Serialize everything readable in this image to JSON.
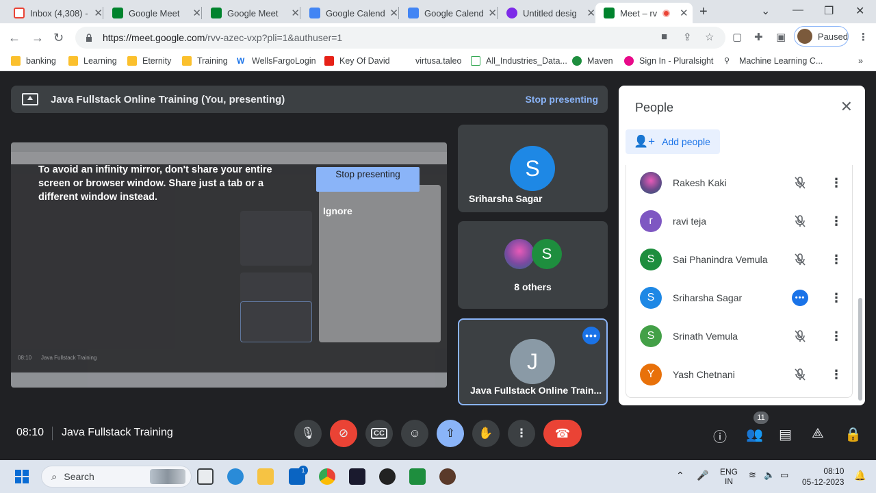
{
  "browser": {
    "tabs": [
      {
        "label": "Inbox (4,308) -",
        "icon": "gmail-icon",
        "color": "#ea4335"
      },
      {
        "label": "Google Meet",
        "icon": "meet-icon",
        "color": "#00832d"
      },
      {
        "label": "Google Meet",
        "icon": "meet-icon",
        "color": "#00832d"
      },
      {
        "label": "Google Calend",
        "icon": "calendar-icon",
        "color": "#4285f4"
      },
      {
        "label": "Google Calend",
        "icon": "calendar-icon",
        "color": "#4285f4"
      },
      {
        "label": "Untitled desig",
        "icon": "canva-icon",
        "color": "#7d2ae8"
      },
      {
        "label": "Meet – rv",
        "icon": "meet-icon",
        "color": "#00832d"
      }
    ],
    "url_host": "https://meet.google.com",
    "url_path": "/rvv-azec-vxp?pli=1&authuser=1",
    "profile_status": "Paused",
    "bookmarks": [
      "banking",
      "Learning",
      "Eternity",
      "Training",
      "WellsFargoLogin",
      "Key Of David",
      "virtusa.taleo",
      "All_Industries_Data...",
      "Maven",
      "Sign In - Pluralsight",
      "Machine Learning C..."
    ],
    "bookmarks_overflow": "»"
  },
  "meet": {
    "presenting_bar": {
      "title": "Java Fullstack Online Training (You, presenting)",
      "stop_label": "Stop presenting"
    },
    "screen": {
      "warning": "To avoid an infinity mirror, don't share your entire screen or browser window. Share just a tab or a different window instead.",
      "stop_button": "Stop presenting",
      "ignore_label": "Ignore",
      "mirror_time": "08:10",
      "mirror_title": "Java Fullstack Training"
    },
    "tiles": [
      {
        "name": "Sriharsha Sagar",
        "initial": "S",
        "color": "#1e88e5"
      },
      {
        "name": "8 others",
        "initial": "S",
        "color": "#1e8e3e"
      },
      {
        "name": "Java Fullstack Online Train...",
        "initial": "J",
        "color": "#8a9aa6"
      }
    ],
    "people_panel": {
      "title": "People",
      "add_people": "Add people",
      "participants": [
        {
          "name": "Rakesh Kaki",
          "initial": "",
          "color": "#6a4a8a",
          "photo": true,
          "status": "muted"
        },
        {
          "name": "ravi teja",
          "initial": "r",
          "color": "#7e57c2",
          "photo": false,
          "status": "muted"
        },
        {
          "name": "Sai Phanindra Vemula",
          "initial": "S",
          "color": "#1e8e3e",
          "photo": false,
          "status": "muted"
        },
        {
          "name": "Sriharsha Sagar",
          "initial": "S",
          "color": "#1e88e5",
          "photo": false,
          "status": "speaking"
        },
        {
          "name": "Srinath Vemula",
          "initial": "S",
          "color": "#43a047",
          "photo": false,
          "status": "muted"
        },
        {
          "name": "Yash Chetnani",
          "initial": "Y",
          "color": "#e8710a",
          "photo": false,
          "status": "muted"
        }
      ]
    },
    "bottom_bar": {
      "time": "08:10",
      "meeting_title": "Java Fullstack Training",
      "participant_count": "11"
    }
  },
  "taskbar": {
    "search_placeholder": "Search",
    "language_top": "ENG",
    "language_bottom": "IN",
    "clock_time": "08:10",
    "clock_date": "05-12-2023",
    "mail_badge": "1"
  }
}
